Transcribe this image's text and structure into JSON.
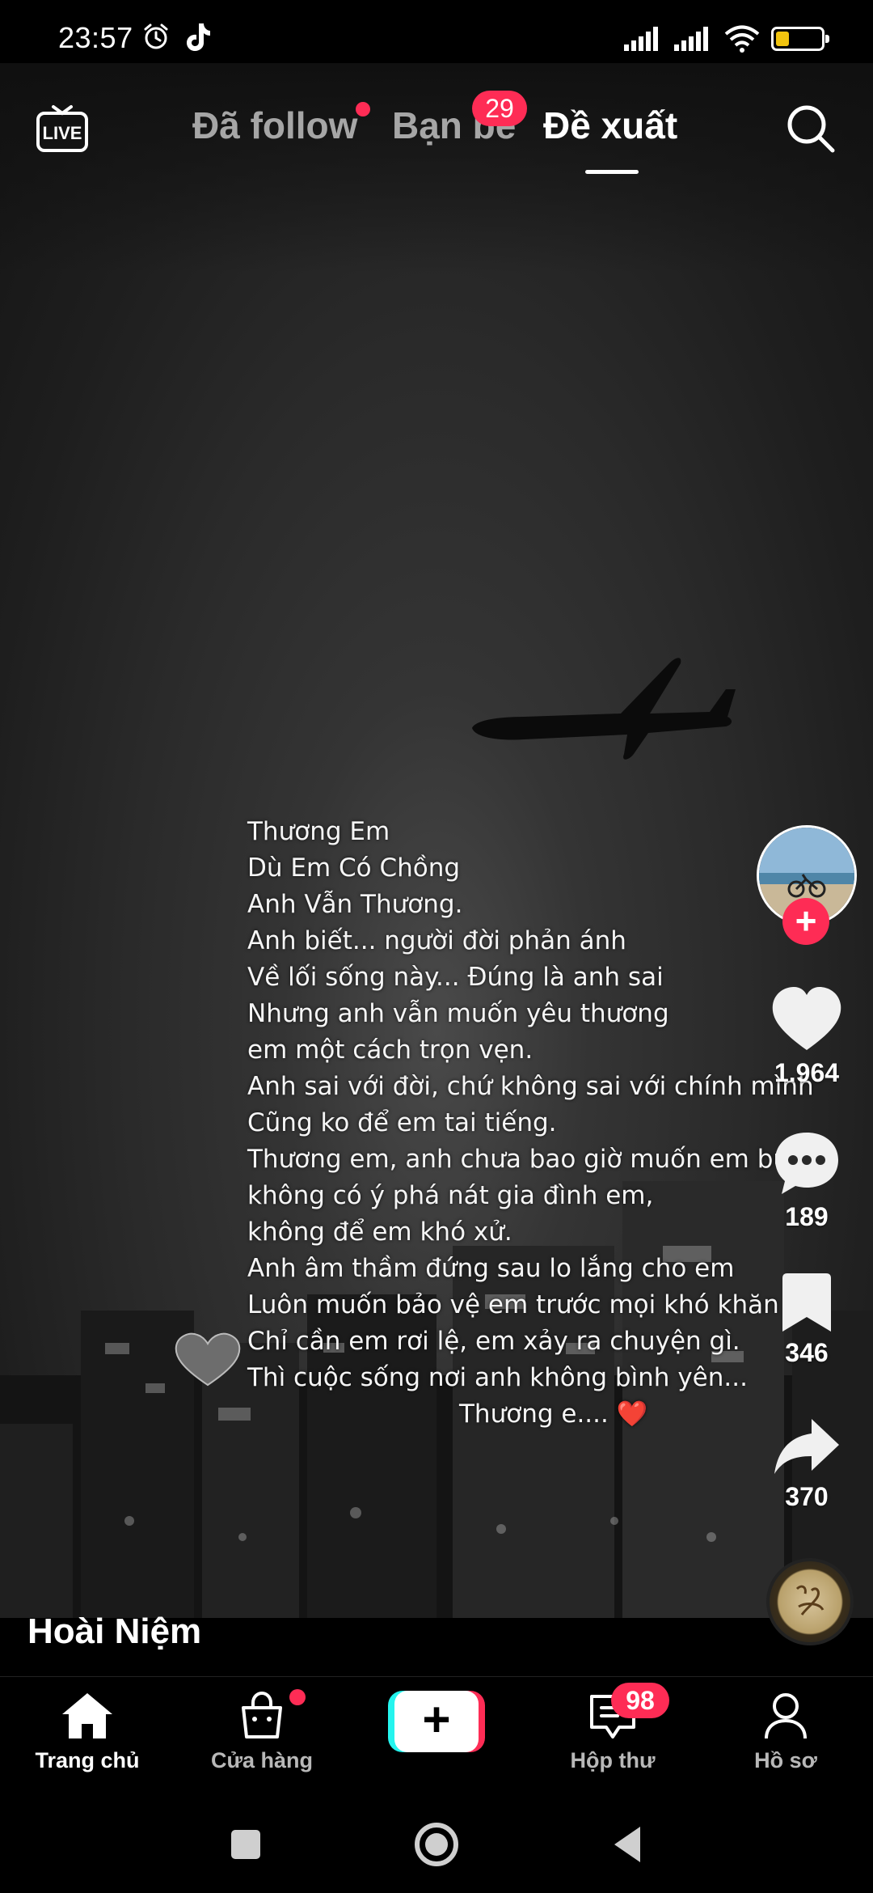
{
  "status_bar": {
    "time": "23:57",
    "battery_level": "29"
  },
  "top_nav": {
    "tabs": [
      {
        "label": "Đã follow"
      },
      {
        "label": "Bạn bè",
        "badge": "29"
      },
      {
        "label": "Đề xuất"
      }
    ],
    "active_tab": "Đề xuất"
  },
  "video": {
    "lyrics": [
      "Thương Em",
      "Dù Em Có Chồng",
      "Anh Vẫn Thương.",
      "Anh biết... người đời phản ánh",
      "Về lối sống này... Đúng là anh sai",
      "Nhưng anh vẫn muốn yêu thương",
      "em một cách trọn vẹn.",
      "Anh sai với đời, chứ không sai với chính mình",
      "Cũng ko để em tai tiếng.",
      "Thương em, anh chưa bao giờ muốn em buồn,",
      "không có ý phá nát gia đình em,",
      "không để em khó xử.",
      "Anh âm thầm đứng sau lo lắng cho em",
      "Luôn muốn bảo vệ em trước mọi khó khăn",
      "Chỉ cần em rơi lệ, em xảy ra chuyện gì.",
      "Thì cuộc sống nơi anh không bình yên...",
      "Thương e.... ❤️"
    ],
    "author": "Hoài Niệm"
  },
  "actions": {
    "likes": "1.964",
    "comments": "189",
    "saves": "346",
    "shares": "370"
  },
  "bottom_nav": {
    "home": "Trang chủ",
    "shop": "Cửa hàng",
    "inbox": "Hộp thư",
    "inbox_badge": "98",
    "profile": "Hồ sơ"
  },
  "colors": {
    "accent": "#fe2c55",
    "cyan": "#25f4ee",
    "battery": "#f1c40f"
  }
}
